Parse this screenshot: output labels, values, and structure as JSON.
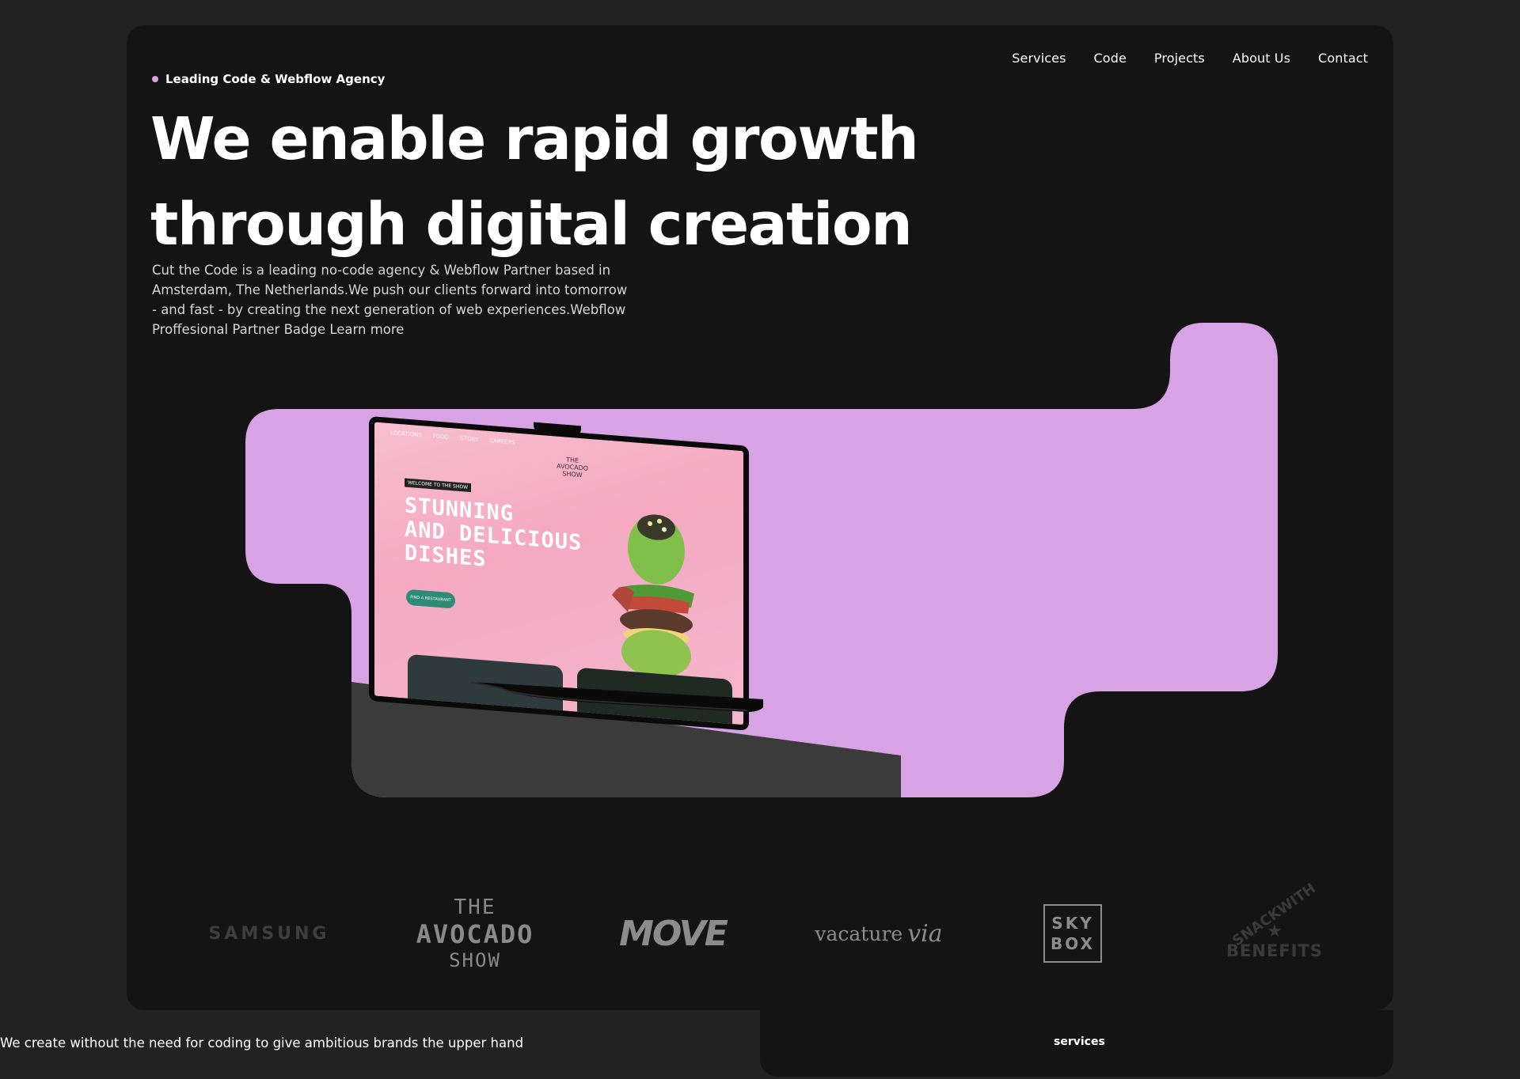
{
  "nav": {
    "items": [
      {
        "label": "Services"
      },
      {
        "label": "Code"
      },
      {
        "label": "Projects"
      },
      {
        "label": "About Us"
      },
      {
        "label": "Contact"
      }
    ]
  },
  "hero": {
    "eyebrow": "Leading Code & Webflow Agency",
    "headline_line1": "We enable rapid growth",
    "headline_line2": "through digital creation",
    "intro": "Cut the Code is a leading no-code agency & Webflow Partner based in Amsterdam, The Netherlands.We push our clients forward into tomorrow - and fast - by creating the next generation of web experiences.Webflow Proffesional Partner Badge Learn more"
  },
  "mockup": {
    "nav": [
      "LOCATIONS",
      "FOOD",
      "STORY",
      "CAREERS"
    ],
    "logo": [
      "THE",
      "AVOCADO",
      "SHOW"
    ],
    "tag": "WELCOME TO THE SHOW",
    "title_line1": "STUNNING",
    "title_line2": "AND DELICIOUS",
    "title_line3": "DISHES",
    "button": "FIND A RESTAURANT"
  },
  "logos": {
    "samsung": "SAMSUNG",
    "avocado_1": "THE",
    "avocado_2": "AVOCADO",
    "avocado_3": "SHOW",
    "move": "MOVE",
    "vacature": "vacature",
    "via": "via",
    "skybox_1": "SKY",
    "skybox_2": "BOX",
    "snack_1": "SNACKWITH",
    "snack_2": "★",
    "snack_3": "BENEFITS"
  },
  "footer": {
    "tagline": "We create without the need for coding to give ambitious brands the upper hand",
    "services_label": "services"
  },
  "colors": {
    "background": "#222222",
    "card": "#141414",
    "accent": "#d8a3e5"
  }
}
